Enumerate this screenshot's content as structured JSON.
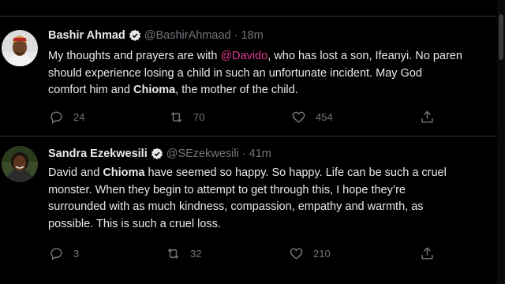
{
  "tweets": [
    {
      "name": "Bashir Ahmad",
      "handle": "@BashirAhmaad",
      "separator": "·",
      "time": "18m",
      "text_parts": {
        "l1_a": "My thoughts and prayers are with ",
        "l1_mention": "@Davido",
        "l1_b": ", who has lost a son, Ifeanyi. No paren",
        "l2": "should experience losing a child in such an unfortunate incident. May God",
        "l3_a": "comfort him and ",
        "l3_bold": "Chioma",
        "l3_b": ", the mother of the child."
      },
      "replies": "24",
      "retweets": "70",
      "likes": "454"
    },
    {
      "name": "Sandra Ezekwesili",
      "handle": "@SEzekwesili",
      "separator": "·",
      "time": "41m",
      "text_parts": {
        "l1_a": "David and ",
        "l1_bold": "Chioma",
        "l1_b": " have seemed so happy. So happy. Life can be such a cruel",
        "l2": "monster. When they begin to attempt to get through this, I hope they’re",
        "l3": "surrounded with as much kindness, compassion, empathy and warmth, as",
        "l4": "possible. This is such a cruel loss."
      },
      "replies": "3",
      "retweets": "32",
      "likes": "210"
    }
  ],
  "icons": {
    "verified": "verified-badge-icon",
    "reply": "reply-icon",
    "retweet": "retweet-icon",
    "like": "heart-icon",
    "share": "share-icon"
  },
  "colors": {
    "background": "#000000",
    "text": "#e7e9ea",
    "muted": "#71767b",
    "mention": "#e0368f",
    "divider": "#2f3336"
  }
}
